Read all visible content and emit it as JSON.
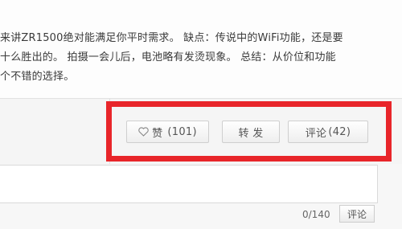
{
  "post": {
    "lines": [
      "来讲ZR1500绝对能满足你平时需求。  缺点：传说中的WiFi功能，还是要",
      "十么胜出的。 拍摄一会儿后，电池略有发烫现象。 总结：从价位和功能",
      "个不错的选择。"
    ]
  },
  "actions": {
    "like_label": "赞",
    "like_count": "(101)",
    "forward_label": "转 发",
    "comment_label": "评论",
    "comment_count": "(42)"
  },
  "comment_box": {
    "counter": "0/140",
    "submit_label": "评论"
  },
  "colors": {
    "highlight": "#e8252a",
    "bar_background": "#f5f5f5"
  },
  "icons": {
    "like": "heart-icon"
  }
}
